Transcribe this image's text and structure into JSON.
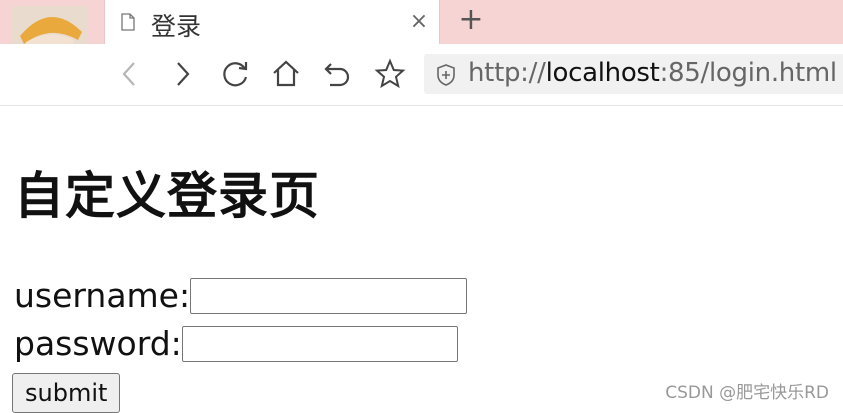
{
  "browser": {
    "tab_title": "登录",
    "tab_close": "×",
    "new_tab": "+",
    "url_scheme": "http://",
    "url_host": "localhost",
    "url_rest": ":85/login.html",
    "chrome_color": "#f7d4d4",
    "icons": {
      "back": "chevron-left-icon",
      "forward": "chevron-right-icon",
      "reload": "reload-icon",
      "home": "home-icon",
      "undo": "undo-icon",
      "bookmark": "star-icon",
      "security": "shield-icon",
      "page": "page-icon"
    }
  },
  "page": {
    "title": "自定义登录页",
    "username_label": "username:",
    "username_value": "",
    "password_label": "password:",
    "password_value": "",
    "submit_label": "submit"
  },
  "watermark": "CSDN @肥宅快乐RD"
}
